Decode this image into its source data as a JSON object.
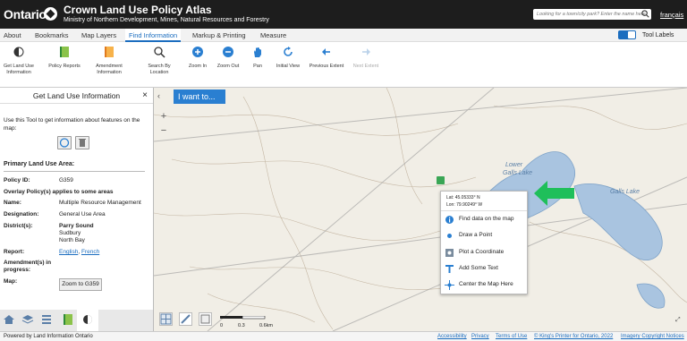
{
  "header": {
    "brand": "Ontario",
    "title": "Crown Land Use Policy Atlas",
    "subtitle": "Ministry of Northern Development, Mines, Natural Resources and Forestry",
    "search_placeholder": "Looking for a town/city park? Enter the name here",
    "language_link": "français"
  },
  "tabs": [
    {
      "label": "About"
    },
    {
      "label": "Bookmarks"
    },
    {
      "label": "Map Layers"
    },
    {
      "label": "Find Information",
      "active": true
    },
    {
      "label": "Markup & Printing"
    },
    {
      "label": "Measure"
    }
  ],
  "tool_labels_toggle": {
    "label": "Tool Labels",
    "on": true
  },
  "toolbar": {
    "tools": [
      {
        "label1": "Get Land Use",
        "label2": "Information",
        "icon": "land-use-icon"
      },
      {
        "label1": "Policy Reports",
        "label2": "",
        "icon": "report-icon"
      },
      {
        "label1": "Amendment",
        "label2": "Information",
        "icon": "amendment-icon"
      },
      {
        "label1": "Search By",
        "label2": "Location",
        "icon": "search-icon"
      },
      {
        "label1": "Zoom In",
        "label2": "",
        "icon": "zoom-in-icon"
      },
      {
        "label1": "Zoom Out",
        "label2": "",
        "icon": "zoom-out-icon"
      },
      {
        "label1": "Pan",
        "label2": "",
        "icon": "pan-icon"
      },
      {
        "label1": "Initial View",
        "label2": "",
        "icon": "initial-view-icon"
      },
      {
        "label1": "Previous Extent",
        "label2": "",
        "icon": "previous-extent-icon"
      },
      {
        "label1": "Next Extent",
        "label2": "",
        "icon": "next-extent-icon",
        "disabled": true
      }
    ]
  },
  "panel": {
    "title": "Get Land Use Information",
    "close": "×",
    "description": "Use this Tool to get information about features on the map:",
    "section_title": "Primary Land Use Area:",
    "policy_id_label": "Policy ID:",
    "policy_id": "G359",
    "overlay_note": "Overlay Policy(s) applies to some areas",
    "name_label": "Name:",
    "name": "Multiple Resource Management",
    "designation_label": "Designation:",
    "designation": "General Use Area",
    "districts_label": "District(s):",
    "districts": [
      "Parry Sound",
      "Sudbury",
      "North Bay"
    ],
    "report_label": "Report:",
    "report_links": [
      "English",
      "French"
    ],
    "amendment_label1": "Amendment(s) in",
    "amendment_label2": "progress:",
    "map_label": "Map:",
    "zoom_button": "Zoom to G359"
  },
  "map": {
    "want_to": "I want to...",
    "collapse": "‹",
    "zoom_in": "+",
    "zoom_out": "−",
    "labels": [
      {
        "text": "Lower",
        "italic": true
      },
      {
        "text": "Galls Lake",
        "italic": true
      },
      {
        "text": "Galls Lake",
        "italic": true
      }
    ],
    "context_menu": {
      "lat": "Lat: 45.05333° N",
      "lon": "Lon: 79.90249° W",
      "items": [
        "Find data on the map",
        "Draw a Point",
        "Plot a Coordinate",
        "Add Some Text",
        "Center the Map Here"
      ]
    },
    "scale": {
      "ticks": [
        "0",
        "0.3",
        "0.6km"
      ]
    }
  },
  "footer": {
    "left": "Powered by Land Information Ontario",
    "links": [
      "Accessibility",
      "Privacy",
      "Terms of Use",
      "© King's Printer for Ontario, 2022",
      "Imagery Copyright Notices"
    ]
  },
  "colors": {
    "header_bg": "#1d1d1d",
    "accent": "#1b6dbf",
    "arrow": "#1fbf5a"
  }
}
